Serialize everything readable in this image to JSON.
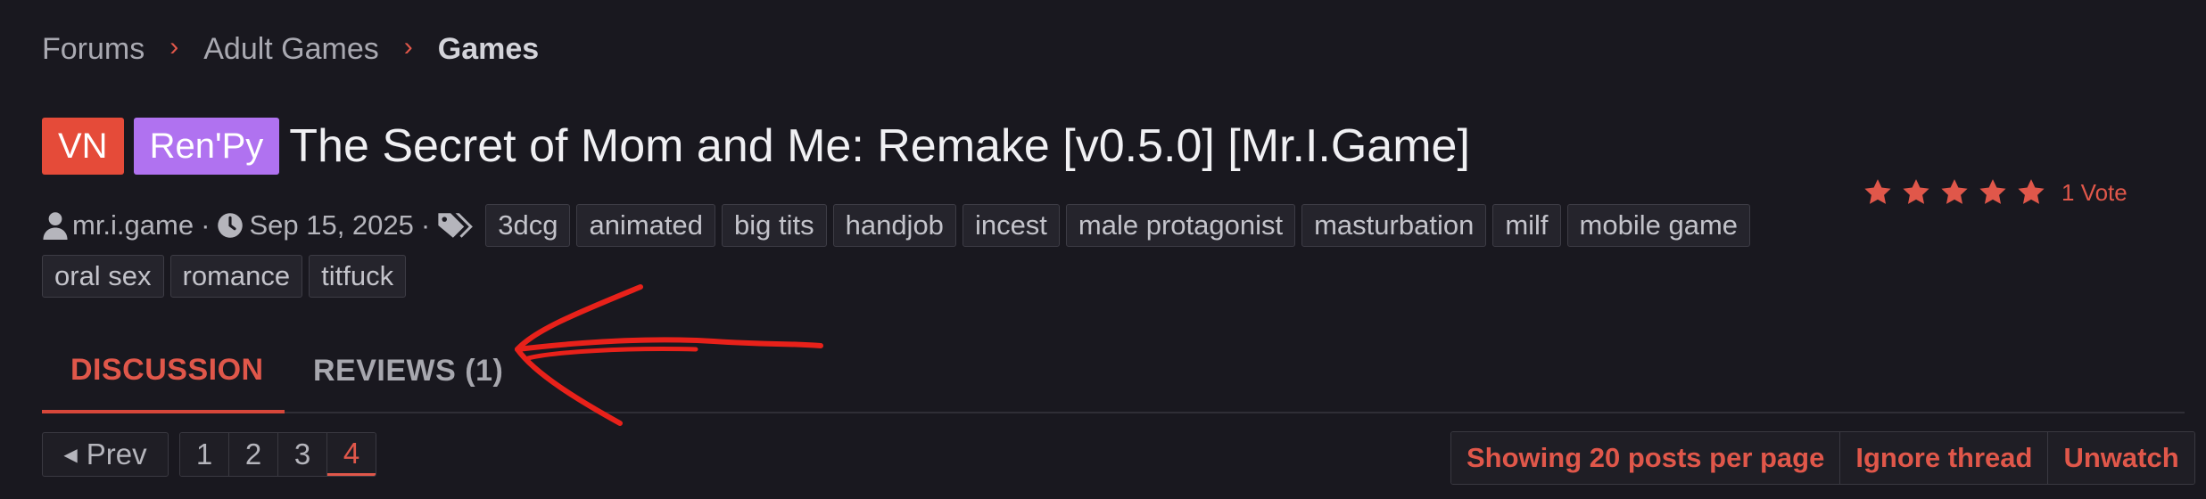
{
  "breadcrumb": [
    "Forums",
    "Adult Games",
    "Games"
  ],
  "prefixes": {
    "vn": "VN",
    "renpy": "Ren'Py"
  },
  "title": "The Secret of Mom and Me: Remake [v0.5.0] [Mr.I.Game]",
  "rating": {
    "stars": 5,
    "max": 5,
    "votes_label": "1 Vote",
    "color": "#e0574a"
  },
  "meta": {
    "author": "mr.i.game",
    "date": "Sep 15, 2025",
    "separator": "·"
  },
  "tags": [
    "3dcg",
    "animated",
    "big tits",
    "handjob",
    "incest",
    "male protagonist",
    "masturbation",
    "milf",
    "mobile game",
    "oral sex",
    "romance",
    "titfuck"
  ],
  "tabs": {
    "discussion": "DISCUSSION",
    "reviews": "REVIEWS (1)"
  },
  "pagination": {
    "prev": "Prev",
    "pages": [
      "1",
      "2",
      "3",
      "4"
    ],
    "current": "4"
  },
  "actions": {
    "per_page": "Showing 20 posts per page",
    "ignore": "Ignore thread",
    "unwatch": "Unwatch"
  },
  "icons": {
    "separator": "chevron-right-icon",
    "author": "user-icon",
    "date": "clock-icon",
    "tags": "tags-icon",
    "rating": "star-icon",
    "prev": "caret-left-icon"
  },
  "colors": {
    "accent": "#e0574a",
    "vn": "#e54b39",
    "renpy": "#b072f0",
    "background": "#19181f",
    "annotation": "#e8211a"
  }
}
